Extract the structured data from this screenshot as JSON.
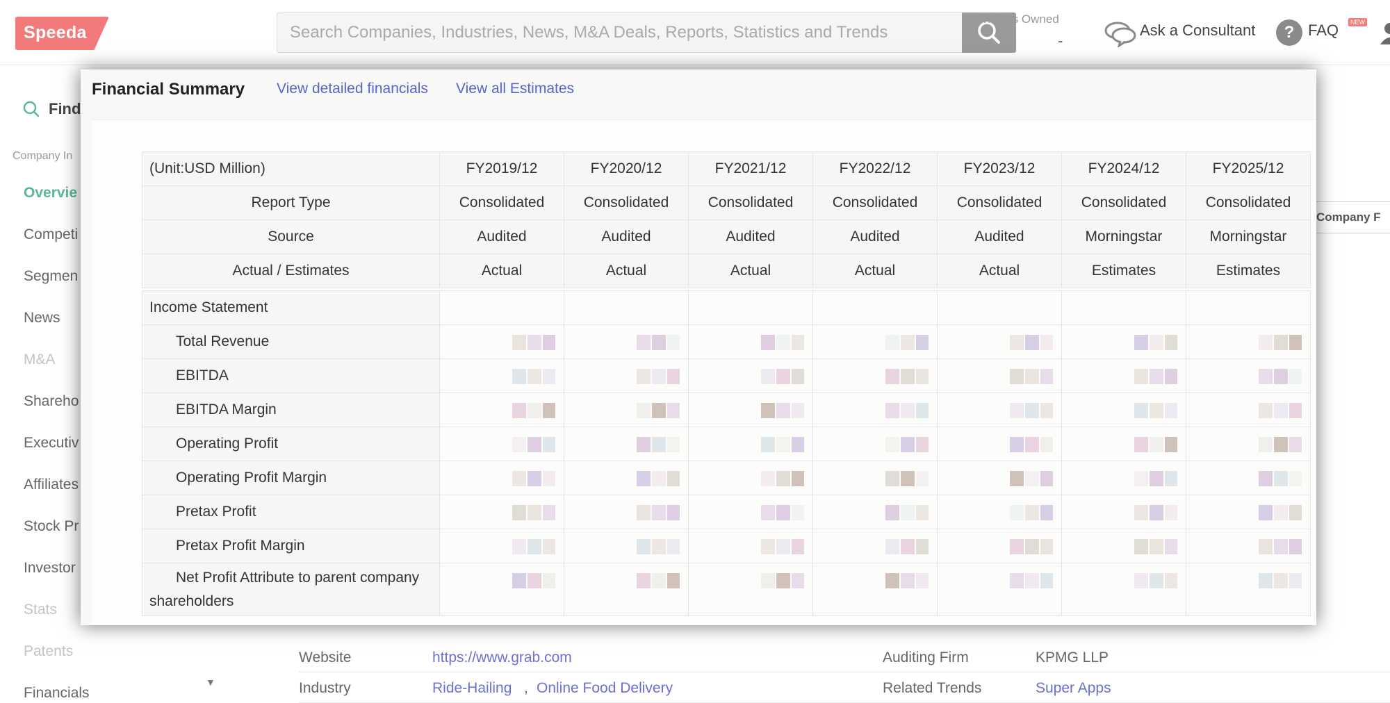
{
  "header": {
    "logo_text": "Speeda",
    "search_placeholder": "Search Companies, Industries, News, M&A Deals, Reports, Statistics and Trends",
    "tickets_label": "Tickets Owned",
    "tickets_value": "-",
    "consult_label": "Ask a Consultant",
    "faq_label": "FAQ",
    "faq_glyph": "?",
    "new_badge": "NEW"
  },
  "sidebar": {
    "find_label": "Find",
    "section_label": "Company In",
    "items": [
      {
        "label": "Overvie",
        "state": "active"
      },
      {
        "label": "Competi",
        "state": "normal"
      },
      {
        "label": "Segmen",
        "state": "normal"
      },
      {
        "label": "News",
        "state": "normal"
      },
      {
        "label": "M&A",
        "state": "disabled"
      },
      {
        "label": "Shareho",
        "state": "normal"
      },
      {
        "label": "Executiv",
        "state": "normal"
      },
      {
        "label": "Affiliates",
        "state": "normal"
      },
      {
        "label": "Stock Pr",
        "state": "normal"
      },
      {
        "label": "Investor",
        "state": "normal"
      },
      {
        "label": "Stats",
        "state": "disabled"
      },
      {
        "label": "Patents",
        "state": "disabled"
      },
      {
        "label": "Financials",
        "state": "normal"
      }
    ]
  },
  "background": {
    "tab_label": "Company F",
    "rows": [
      {
        "label": "Website",
        "value": "https://www.grab.com",
        "label2": "Auditing Firm",
        "value2": "KPMG LLP"
      },
      {
        "label": "Industry",
        "value": "Ride-Hailing",
        "value_b": "Online Food Delivery",
        "separator": ",",
        "label2": "Related Trends",
        "value2": "Super Apps"
      }
    ]
  },
  "modal": {
    "title": "Financial Summary",
    "link_detailed": "View detailed financials",
    "link_estimates": "View all Estimates",
    "unit_label": "(Unit:USD Million)",
    "years": [
      "FY2019/12",
      "FY2020/12",
      "FY2021/12",
      "FY2022/12",
      "FY2023/12",
      "FY2024/12",
      "FY2025/12"
    ],
    "meta_rows": [
      {
        "label": "Report Type",
        "values": [
          "Consolidated",
          "Consolidated",
          "Consolidated",
          "Consolidated",
          "Consolidated",
          "Consolidated",
          "Consolidated"
        ]
      },
      {
        "label": "Source",
        "values": [
          "Audited",
          "Audited",
          "Audited",
          "Audited",
          "Audited",
          "Morningstar",
          "Morningstar"
        ]
      },
      {
        "label": "Actual / Estimates",
        "values": [
          "Actual",
          "Actual",
          "Actual",
          "Actual",
          "Actual",
          "Estimates",
          "Estimates"
        ]
      }
    ],
    "section_label": "Income Statement",
    "metrics": [
      "Total Revenue",
      "EBITDA",
      "EBITDA Margin",
      "Operating Profit",
      "Operating Profit Margin",
      "Pretax Profit",
      "Pretax Profit Margin",
      "Net Profit Attribute to parent company shareholders"
    ]
  }
}
